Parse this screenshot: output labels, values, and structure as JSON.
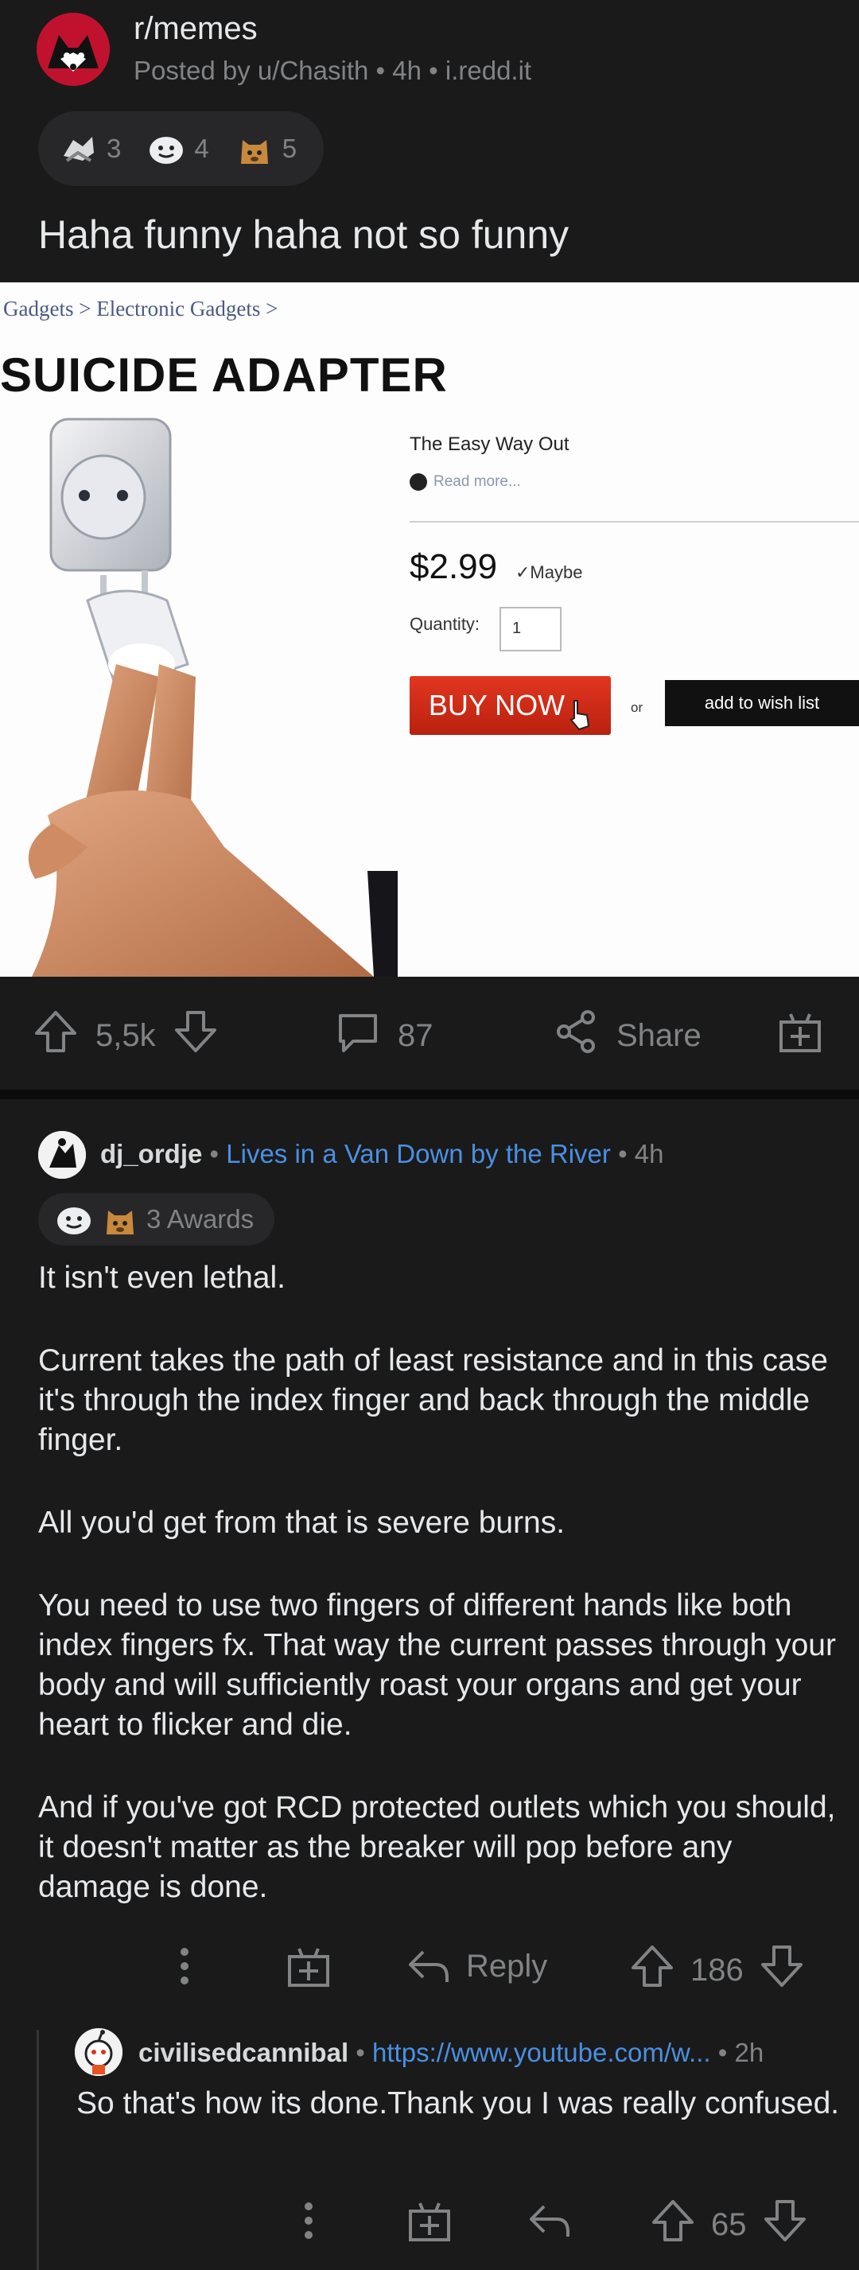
{
  "post": {
    "subreddit": "r/memes",
    "posted_by": "Posted by u/Chasith",
    "age": "4h",
    "domain": "i.redd.it",
    "awards": [
      {
        "icon": "wholesome-seal-award-icon",
        "count": "3"
      },
      {
        "icon": "helpful-award-icon",
        "count": "4"
      },
      {
        "icon": "doge-award-icon",
        "count": "5"
      }
    ],
    "title": "Haha funny haha not so funny",
    "meme": {
      "breadcrumb": "Gadgets > Electronic Gadgets >",
      "product_title": "SUICIDE ADAPTER",
      "tagline": "The Easy Way Out",
      "read_more": "Read more...",
      "price": "$2.99",
      "maybe": "✓Maybe",
      "quantity_label": "Quantity:",
      "quantity_value": "1",
      "buy_button": "BUY NOW",
      "or": "or",
      "wish_button": "add to wish list"
    },
    "actions": {
      "score": "5,5k",
      "comments": "87",
      "share": "Share"
    }
  },
  "comment": {
    "username": "dj_ordje",
    "flair": "Lives in a Van Down by the River",
    "age": "4h",
    "awards_label": "3 Awards",
    "body": [
      "It isn't even lethal.",
      "Current takes the path of least resistance and in this case it's through the index finger and back through the middle finger.",
      "All you'd get from that is severe burns.",
      "You need to use two fingers of different hands like both index fingers fx. That way the current passes through your body and will sufficiently roast your organs and get your heart to flicker and die.",
      "And if you've got RCD protected outlets which you should, it doesn't matter as the breaker will pop before any damage is done."
    ],
    "reply_label": "Reply",
    "score": "186"
  },
  "reply": {
    "username": "civilisedcannibal",
    "link": "https://www.youtube.com/w...",
    "age": "2h",
    "body": "So that's how its done.Thank you I was really confused.",
    "score": "65"
  },
  "colors": {
    "background": "#0b0b0c",
    "card": "#1a1a1b",
    "pill": "#272729",
    "muted": "#818384",
    "link": "#4a90e2",
    "buy_button": "#c82b16"
  }
}
